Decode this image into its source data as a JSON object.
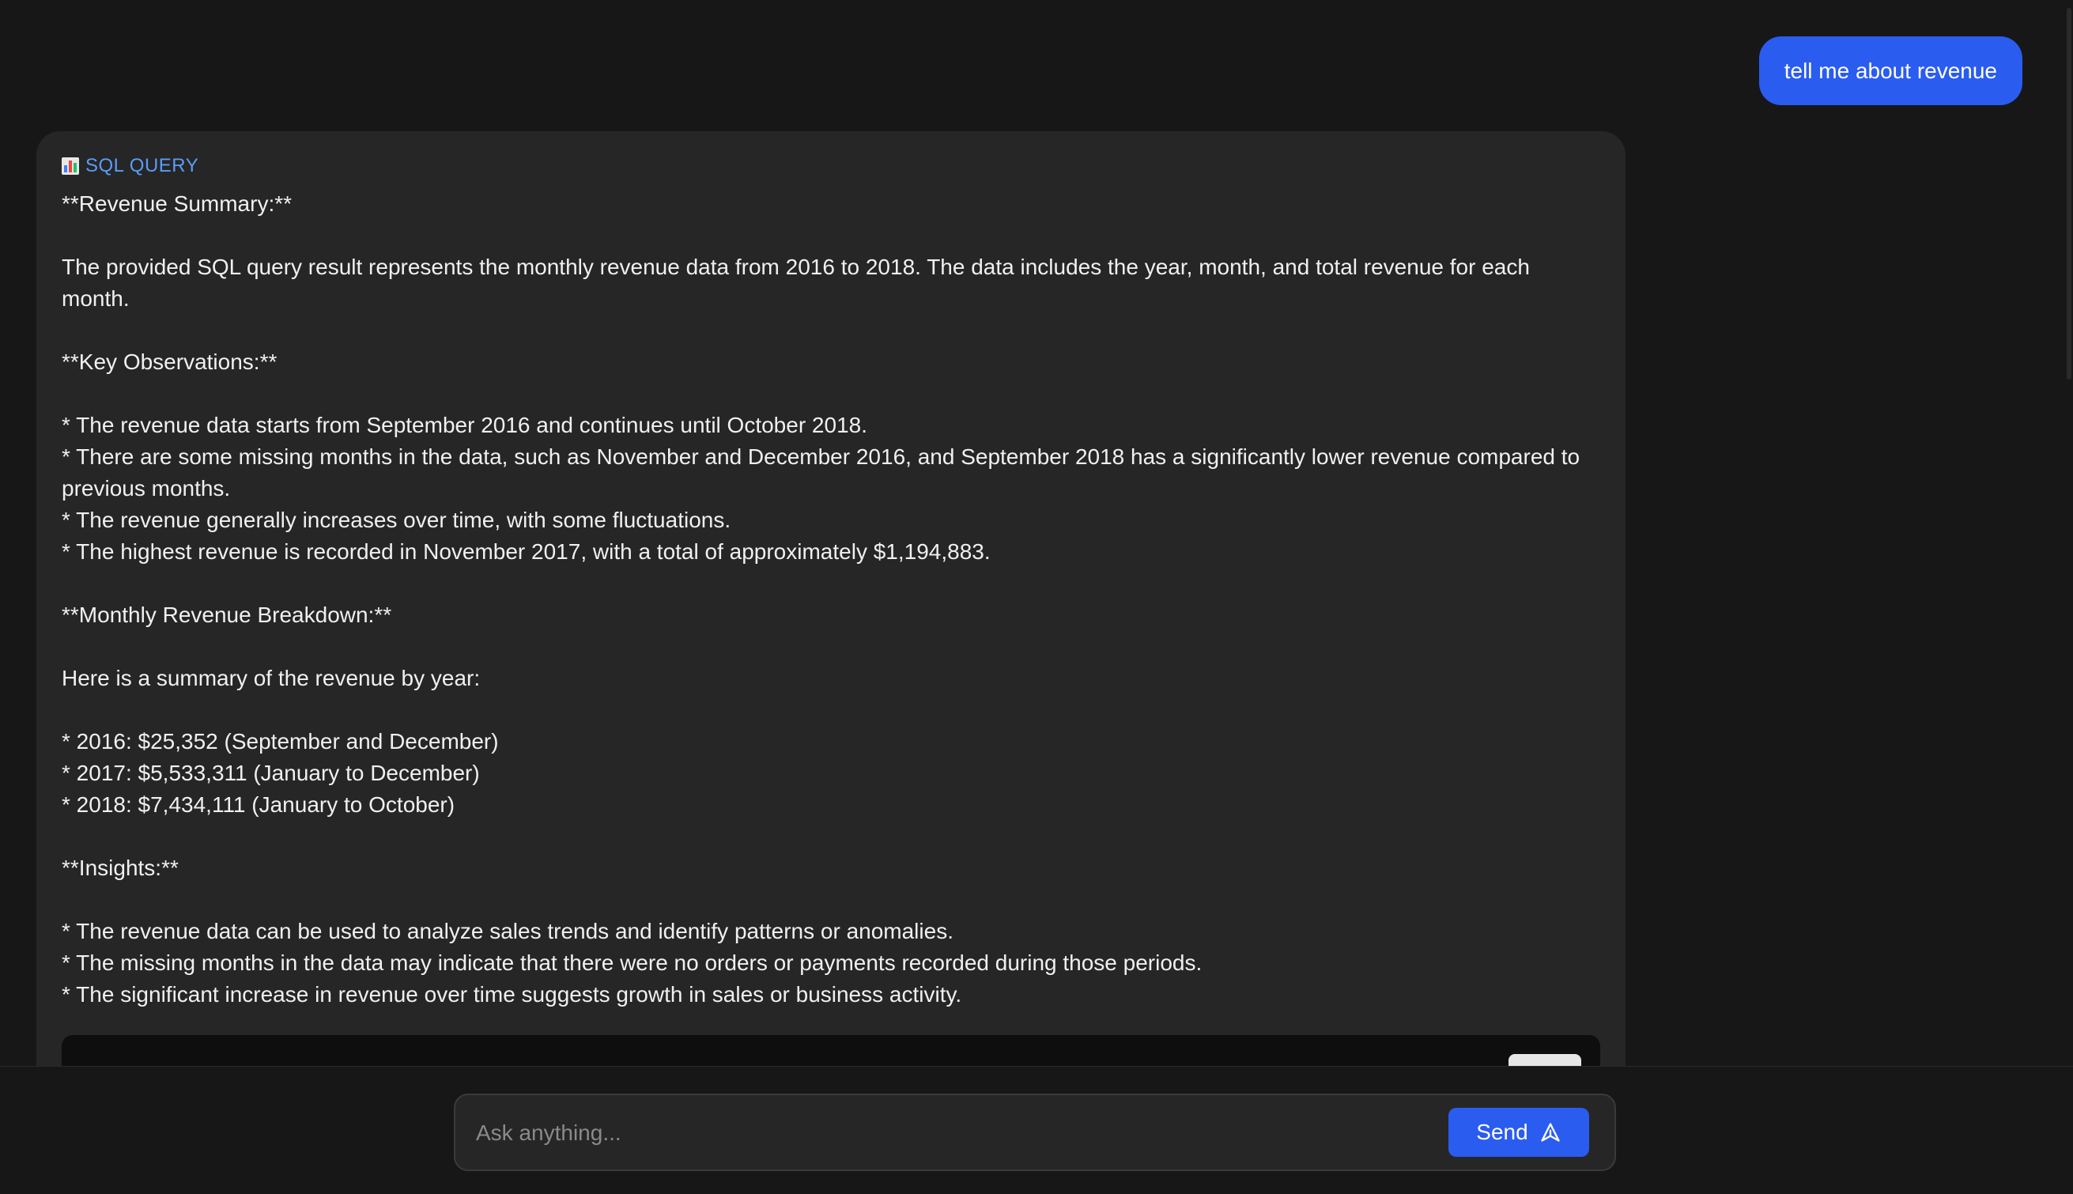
{
  "user_message": {
    "text": "tell me about revenue"
  },
  "assistant": {
    "label": "SQL QUERY",
    "label_icon": "bar-chart-icon",
    "response": "**Revenue Summary:**\n\nThe provided SQL query result represents the monthly revenue data from 2016 to 2018. The data includes the year, month, and total revenue for each month.\n\n**Key Observations:**\n\n* The revenue data starts from September 2016 and continues until October 2018.\n* There are some missing months in the data, such as November and December 2016, and September 2018 has a significantly lower revenue compared to previous months.\n* The revenue generally increases over time, with some fluctuations.\n* The highest revenue is recorded in November 2017, with a total of approximately $1,194,883.\n\n**Monthly Revenue Breakdown:**\n\nHere is a summary of the revenue by year:\n\n* 2016: $25,352 (September and December)\n* 2017: $5,533,311 (January to December)\n* 2018: $7,434,111 (January to October)\n\n**Insights:**\n\n* The revenue data can be used to analyze sales trends and identify patterns or anomalies.\n* The missing months in the data may indicate that there were no orders or payments recorded during those periods.\n* The significant increase in revenue over time suggests growth in sales or business activity."
  },
  "composer": {
    "placeholder": "Ask anything...",
    "value": "",
    "send_label": "Send",
    "send_icon": "send-icon"
  },
  "colors": {
    "background": "#171717",
    "card": "#262626",
    "accent": "#2a5cf0",
    "label": "#5b9cf6"
  }
}
